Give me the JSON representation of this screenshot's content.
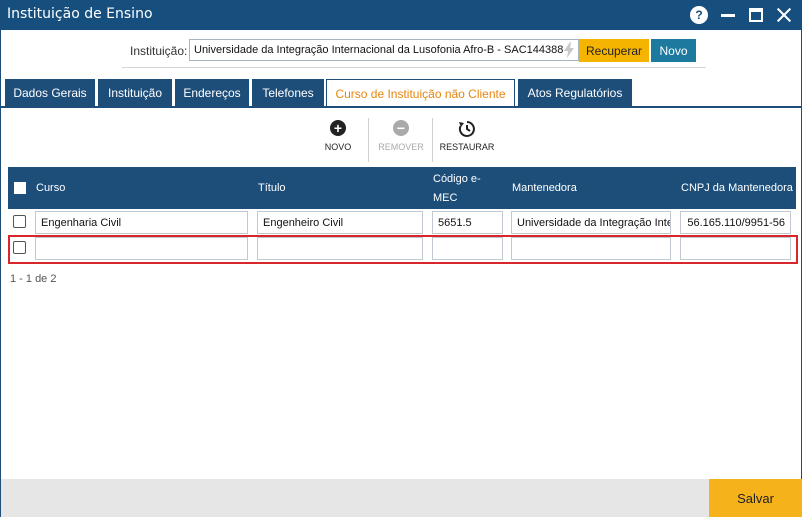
{
  "window": {
    "title": "Instituição de Ensino",
    "help_glyph": "?"
  },
  "institution": {
    "label": "Instituição:",
    "value": "Universidade da Integração Internacional da Lusofonia Afro-B - SAC144388",
    "recuperar_label": "Recuperar",
    "novo_label": "Novo"
  },
  "tabs": [
    {
      "label": "Dados Gerais"
    },
    {
      "label": "Instituição"
    },
    {
      "label": "Endereços"
    },
    {
      "label": "Telefones"
    },
    {
      "label": "Curso de Instituição não Cliente",
      "active": true
    },
    {
      "label": "Atos Regulatórios"
    }
  ],
  "toolbar": {
    "novo_label": "NOVO",
    "remover_label": "REMOVER",
    "restaurar_label": "RESTAURAR"
  },
  "grid": {
    "headers": [
      "Curso",
      "Título",
      "Código e-MEC",
      "Mantenedora",
      "CNPJ da Mantenedora"
    ],
    "header_codigo_line1": "Código e-",
    "header_codigo_line2": "MEC",
    "rows": [
      {
        "curso": "Engenharia Civil",
        "titulo": "Engenheiro Civil",
        "codigo": "5651.5",
        "mantenedora": "Universidade da Integração Inter",
        "cnpj": "56.165.110/9951-56"
      },
      {
        "curso": "",
        "titulo": "",
        "codigo": "",
        "mantenedora": "",
        "cnpj": ""
      }
    ],
    "pager": "1 - 1 de 2"
  },
  "footer": {
    "salvar_label": "Salvar"
  },
  "colors": {
    "primary": "#1d4e7a",
    "accent_orange": "#e8860f",
    "button_yellow": "#f4b400",
    "button_teal": "#1d7a9e",
    "highlight_red": "#d9262c"
  }
}
